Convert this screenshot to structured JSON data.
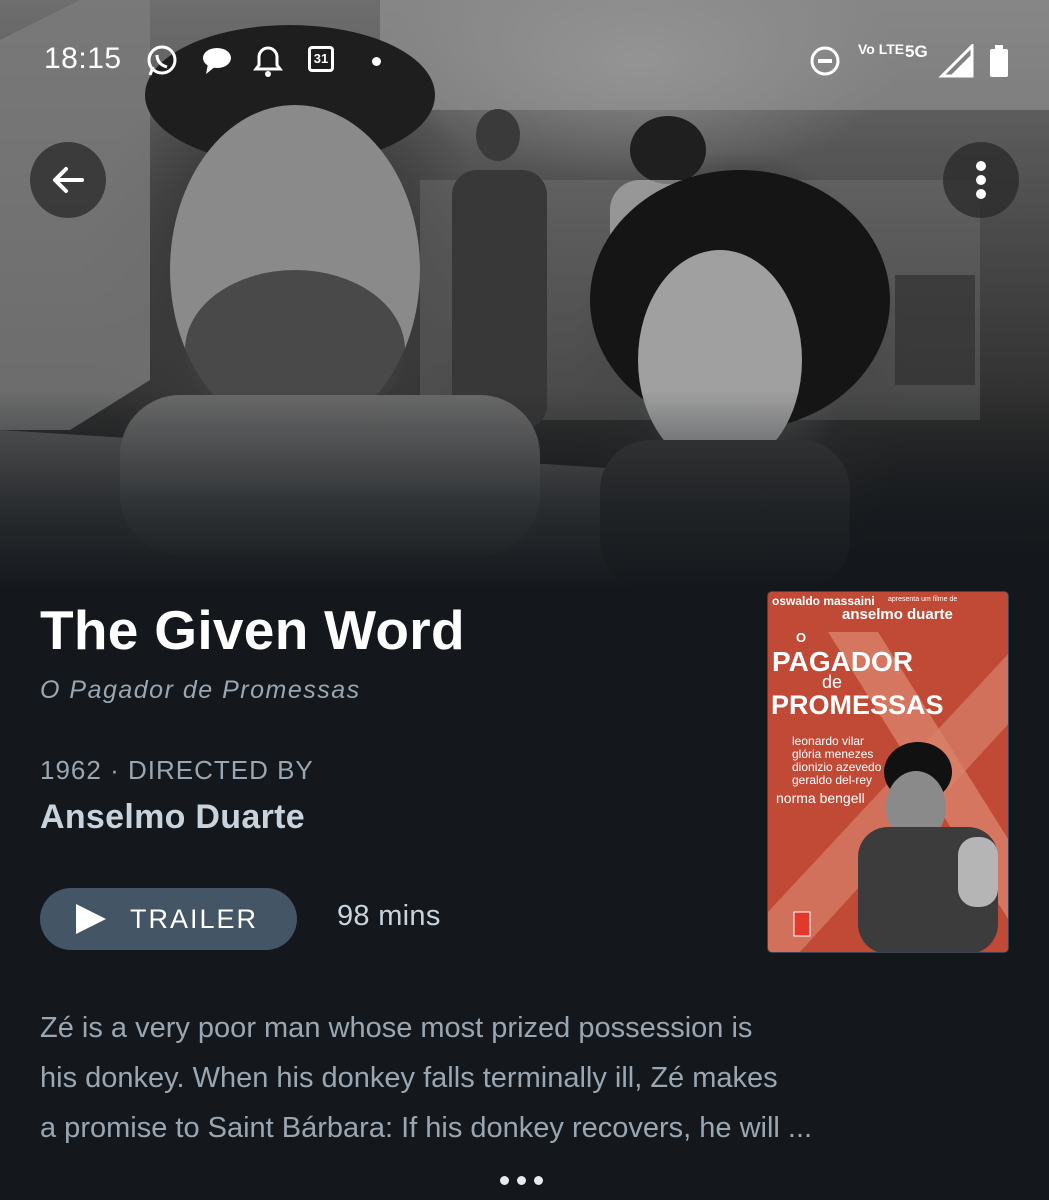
{
  "status_bar": {
    "time": "18:15",
    "calendar_day": "31",
    "network_volte": "Vo LTE",
    "network_type": "5G",
    "icons": [
      "whatsapp-icon",
      "chat-bubble-icon",
      "bell-icon",
      "calendar-icon",
      "dnd-icon",
      "signal-icon",
      "battery-icon"
    ]
  },
  "nav": {
    "back_icon": "arrow-left-icon",
    "more_icon": "more-vertical-icon"
  },
  "film": {
    "title": "The Given Word",
    "original_title": "O Pagador de Promessas",
    "year_directed": "1962 · DIRECTED BY",
    "director": "Anselmo Duarte",
    "trailer_label": "TRAILER",
    "runtime": "98 mins",
    "synopsis": [
      "Zé is a very poor man whose most prized possession is",
      "his donkey. When his donkey falls terminally ill, Zé makes",
      "a promise to Saint Bárbara: If his donkey recovers, he will ..."
    ]
  },
  "poster": {
    "producer": "oswaldo massaini",
    "presents": "apresenta um filme de",
    "director": "anselmo duarte",
    "title_o": "O",
    "title_pagador": "PAGADOR",
    "title_de": "de",
    "title_promessas": "PROMESSAS",
    "cast": [
      "leonardo vilar",
      "glória menezes",
      "dionizio azevedo",
      "geraldo del-rey",
      "norma bengell"
    ]
  },
  "colors": {
    "background": "#14181c",
    "accent_button": "#445566",
    "secondary_text": "#9aa6b2",
    "poster_red": "#c8553f"
  }
}
